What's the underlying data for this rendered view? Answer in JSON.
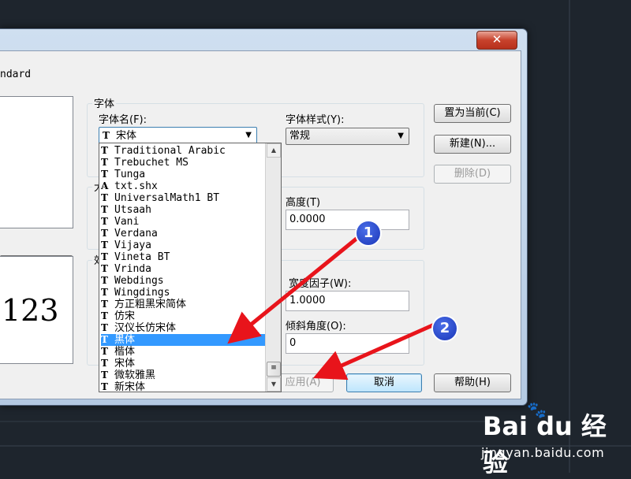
{
  "dialog": {
    "close_label": "✕",
    "style_name_partial": "ndard",
    "current_button": "置为当前(C)",
    "new_button": "新建(N)...",
    "delete_button": "删除(D)",
    "apply_button": "应用(A)",
    "cancel_button": "取消",
    "help_button": "帮助(H)",
    "size_group_partial": "大",
    "effect_group_partial": "效",
    "preview_text": "123"
  },
  "font_group": {
    "title": "字体",
    "font_name_label": "字体名(F):",
    "font_name_value": "宋体",
    "font_style_label": "字体样式(Y):",
    "font_style_value": "常规"
  },
  "size": {
    "height_label": "高度(T)",
    "height_value": "0.0000"
  },
  "effects": {
    "width_factor_label": "宽度因子(W):",
    "width_factor_value": "1.0000",
    "oblique_label": "倾斜角度(O):",
    "oblique_value": "0"
  },
  "font_list": [
    {
      "name": "Traditional Arabic",
      "icon": "T"
    },
    {
      "name": "Trebuchet MS",
      "icon": "T"
    },
    {
      "name": "Tunga",
      "icon": "T"
    },
    {
      "name": "txt.shx",
      "icon": "A"
    },
    {
      "name": "UniversalMath1 BT",
      "icon": "T"
    },
    {
      "name": "Utsaah",
      "icon": "T"
    },
    {
      "name": "Vani",
      "icon": "T"
    },
    {
      "name": "Verdana",
      "icon": "T"
    },
    {
      "name": "Vijaya",
      "icon": "T"
    },
    {
      "name": "Vineta BT",
      "icon": "T"
    },
    {
      "name": "Vrinda",
      "icon": "T"
    },
    {
      "name": "Webdings",
      "icon": "T"
    },
    {
      "name": "Wingdings",
      "icon": "T"
    },
    {
      "name": "方正粗黑宋简体",
      "icon": "T"
    },
    {
      "name": "仿宋",
      "icon": "T"
    },
    {
      "name": "汉仪长仿宋体",
      "icon": "T"
    },
    {
      "name": "黑体",
      "icon": "T"
    },
    {
      "name": "楷体",
      "icon": "T"
    },
    {
      "name": "宋体",
      "icon": "T"
    },
    {
      "name": "微软雅黑",
      "icon": "T"
    },
    {
      "name": "新宋体",
      "icon": "T"
    }
  ],
  "selected_index": 16,
  "annotations": {
    "step1": "1",
    "step2": "2"
  },
  "watermark": {
    "logo": "Bai du 经验",
    "url": "jingyan.baidu.com"
  },
  "colors": {
    "arrow": "#e8141b",
    "badge": "#1a36b8",
    "selection": "#3399ff"
  }
}
